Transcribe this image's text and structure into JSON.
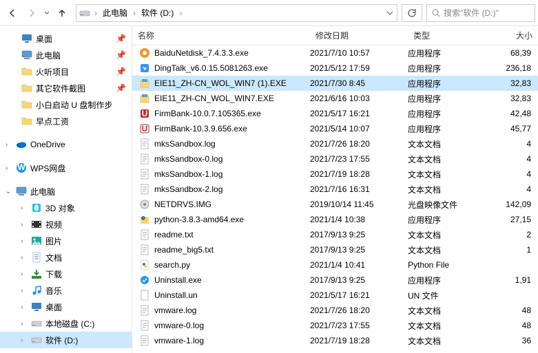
{
  "breadcrumb": {
    "loc1": "此电脑",
    "loc2": "软件 (D:)"
  },
  "search": {
    "placeholder": "搜索\"软件 (D:)\""
  },
  "sidebar": {
    "quick": [
      {
        "label": "桌面",
        "icon": "desktop",
        "pin": true
      },
      {
        "label": "此电脑",
        "icon": "pc",
        "pin": true
      },
      {
        "label": "火听项目",
        "icon": "folder",
        "pin": true
      },
      {
        "label": "其它软件截图",
        "icon": "folder",
        "pin": true
      },
      {
        "label": "小白启动 U 盘制作步",
        "icon": "folder",
        "pin": false
      },
      {
        "label": "早点工资",
        "icon": "folder",
        "pin": false
      }
    ],
    "onedrive": "OneDrive",
    "wps": "WPS网盘",
    "thispc": "此电脑",
    "pcitems": [
      {
        "label": "3D 对象",
        "icon": "3d"
      },
      {
        "label": "视频",
        "icon": "video"
      },
      {
        "label": "图片",
        "icon": "pics"
      },
      {
        "label": "文档",
        "icon": "docs"
      },
      {
        "label": "下载",
        "icon": "dl"
      },
      {
        "label": "音乐",
        "icon": "music"
      },
      {
        "label": "桌面",
        "icon": "desktop"
      },
      {
        "label": "本地磁盘 (C:)",
        "icon": "drive"
      },
      {
        "label": "软件 (D:)",
        "icon": "drive",
        "selected": true
      }
    ]
  },
  "columns": {
    "name": "名称",
    "date": "修改日期",
    "type": "类型",
    "size": "大小"
  },
  "files": [
    {
      "name": "BaiduNetdisk_7.4.3.3.exe",
      "date": "2021/7/10 10:57",
      "type": "应用程序",
      "size": "68,39",
      "icon": "baidu"
    },
    {
      "name": "DingTalk_v6.0.15.5081263.exe",
      "date": "2021/5/12 17:59",
      "type": "应用程序",
      "size": "236,18",
      "icon": "ding"
    },
    {
      "name": "EIE11_ZH-CN_WOL_WIN7 (1).EXE",
      "date": "2021/7/30 8:45",
      "type": "应用程序",
      "size": "32,83",
      "icon": "installer",
      "selected": true
    },
    {
      "name": "EIE11_ZH-CN_WOL_WIN7.EXE",
      "date": "2021/6/16 10:03",
      "type": "应用程序",
      "size": "32,83",
      "icon": "installer"
    },
    {
      "name": "FirmBank-10.0.7.105365.exe",
      "date": "2021/5/17 16:21",
      "type": "应用程序",
      "size": "42,48",
      "icon": "fb"
    },
    {
      "name": "FirmBank-10.3.9.656.exe",
      "date": "2021/5/14 10:07",
      "type": "应用程序",
      "size": "45,77",
      "icon": "fb2"
    },
    {
      "name": "mksSandbox.log",
      "date": "2021/7/26 18:20",
      "type": "文本文档",
      "size": "4",
      "icon": "txt"
    },
    {
      "name": "mksSandbox-0.log",
      "date": "2021/7/23 17:55",
      "type": "文本文档",
      "size": "4",
      "icon": "txt"
    },
    {
      "name": "mksSandbox-1.log",
      "date": "2021/7/19 18:28",
      "type": "文本文档",
      "size": "4",
      "icon": "txt"
    },
    {
      "name": "mksSandbox-2.log",
      "date": "2021/7/16 16:31",
      "type": "文本文档",
      "size": "4",
      "icon": "txt"
    },
    {
      "name": "NETDRVS.IMG",
      "date": "2019/10/14 11:45",
      "type": "光盘映像文件",
      "size": "142,09",
      "icon": "img"
    },
    {
      "name": "python-3.8.3-amd64.exe",
      "date": "2021/1/4 10:38",
      "type": "应用程序",
      "size": "27,15",
      "icon": "py-exe"
    },
    {
      "name": "readme.txt",
      "date": "2017/9/13 9:25",
      "type": "文本文档",
      "size": "2",
      "icon": "txt"
    },
    {
      "name": "readme_big5.txt",
      "date": "2017/9/13 9:25",
      "type": "文本文档",
      "size": "1",
      "icon": "txt"
    },
    {
      "name": "search.py",
      "date": "2021/1/4 10:41",
      "type": "Python File",
      "size": "",
      "icon": "py"
    },
    {
      "name": "Uninstall.exe",
      "date": "2017/9/13 9:25",
      "type": "应用程序",
      "size": "1,91",
      "icon": "uninst"
    },
    {
      "name": "Uninstall.un",
      "date": "2021/5/17 16:21",
      "type": "UN 文件",
      "size": "",
      "icon": "file"
    },
    {
      "name": "vmware.log",
      "date": "2021/7/26 18:20",
      "type": "文本文档",
      "size": "48",
      "icon": "txt"
    },
    {
      "name": "vmware-0.log",
      "date": "2021/7/23 17:55",
      "type": "文本文档",
      "size": "48",
      "icon": "txt"
    },
    {
      "name": "vmware-1.log",
      "date": "2021/7/19 18:28",
      "type": "文本文档",
      "size": "36",
      "icon": "txt"
    }
  ]
}
